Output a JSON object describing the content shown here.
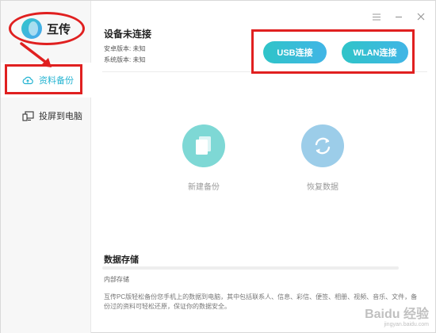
{
  "app": {
    "name": "互传"
  },
  "sidebar": {
    "items": [
      {
        "label": "资料备份",
        "icon": "cloud-backup-icon",
        "active": true
      },
      {
        "label": "投屏到电脑",
        "icon": "screen-cast-icon",
        "active": false
      }
    ]
  },
  "header": {
    "title": "设备未连接",
    "android_version": "安卓版本: 未知",
    "system_version": "系统版本: 未知",
    "usb_button": "USB连接",
    "wlan_button": "WLAN连接"
  },
  "actions": {
    "new_backup": "新建备份",
    "restore": "恢复数据"
  },
  "storage": {
    "title": "数据存储",
    "label": "内部存储",
    "description": "互传PC版轻松备份您手机上的数据到电脑，其中包括联系人、信息、彩信、便签、相册、视频、音乐、文件，备份过的资料可轻松还原，保证你的数据安全。"
  },
  "watermark": {
    "text": "Baidu 经验",
    "sub": "jingyan.baidu.com"
  },
  "colors": {
    "accent": "#25b4d2",
    "button_gradient_start": "#2fc4c8",
    "button_gradient_end": "#41b5e6",
    "annotation": "#e02020"
  }
}
